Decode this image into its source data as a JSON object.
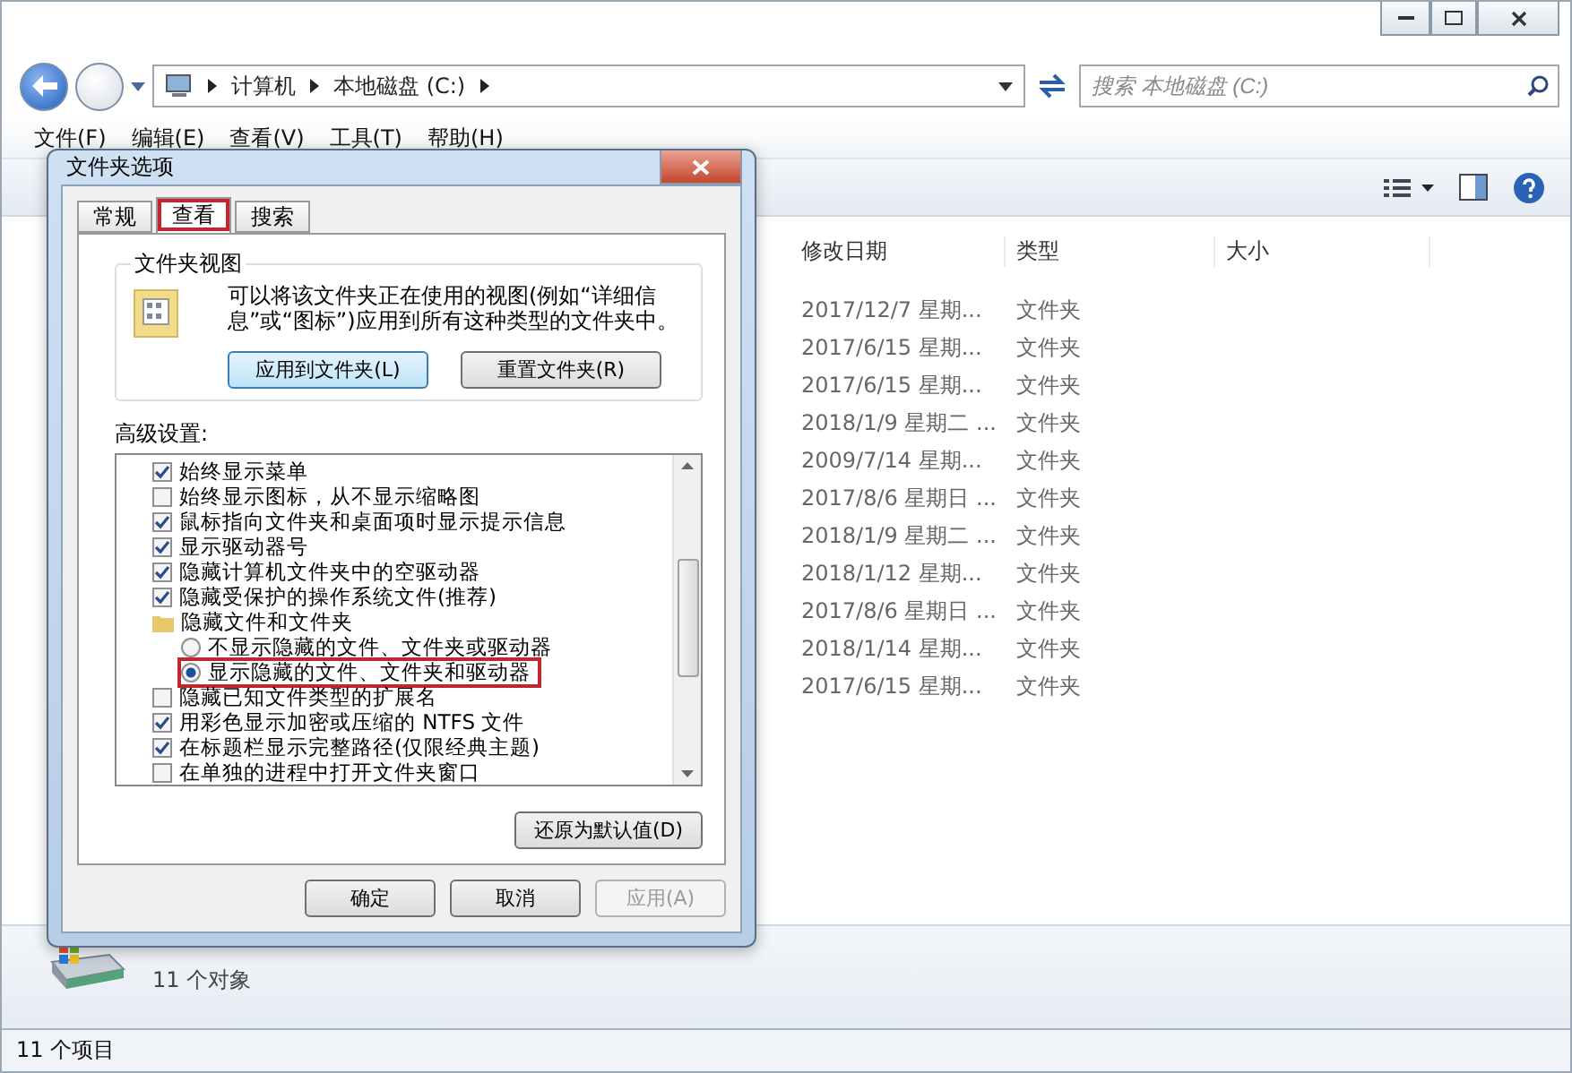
{
  "explorer": {
    "breadcrumb": [
      "计算机",
      "本地磁盘 (C:)"
    ],
    "search": {
      "placeholder": "搜索 本地磁盘 (C:)"
    },
    "menu": [
      "文件(F)",
      "编辑(E)",
      "查看(V)",
      "工具(T)",
      "帮助(H)"
    ],
    "columns": [
      "修改日期",
      "类型",
      "大小"
    ],
    "rows": [
      {
        "date": "2017/12/7 星期...",
        "type": "文件夹"
      },
      {
        "date": "2017/6/15 星期...",
        "type": "文件夹"
      },
      {
        "date": "2017/6/15 星期...",
        "type": "文件夹"
      },
      {
        "date": "2018/1/9 星期二 ...",
        "type": "文件夹"
      },
      {
        "date": "2009/7/14 星期...",
        "type": "文件夹"
      },
      {
        "date": "2017/8/6 星期日 ...",
        "type": "文件夹"
      },
      {
        "date": "2018/1/9 星期二 ...",
        "type": "文件夹"
      },
      {
        "date": "2018/1/12 星期...",
        "type": "文件夹"
      },
      {
        "date": "2017/8/6 星期日 ...",
        "type": "文件夹"
      },
      {
        "date": "2018/1/14 星期...",
        "type": "文件夹"
      },
      {
        "date": "2017/6/15 星期...",
        "type": "文件夹"
      }
    ],
    "details": "11 个对象",
    "status_bar": "11 个项目"
  },
  "dialog": {
    "title": "文件夹选项",
    "tabs": [
      {
        "label": "常规",
        "selected": false,
        "highlighted": false
      },
      {
        "label": "查看",
        "selected": true,
        "highlighted": true
      },
      {
        "label": "搜索",
        "selected": false,
        "highlighted": false
      }
    ],
    "folder_views": {
      "title": "文件夹视图",
      "description": "可以将该文件夹正在使用的视图(例如“详细信息”或“图标”)应用到所有这种类型的文件夹中。",
      "buttons": [
        "应用到文件夹(L)",
        "重置文件夹(R)"
      ]
    },
    "advanced_label": "高级设置:",
    "settings": [
      {
        "kind": "checkbox",
        "label": "始终显示菜单",
        "checked": true
      },
      {
        "kind": "checkbox",
        "label": "始终显示图标，从不显示缩略图",
        "checked": false
      },
      {
        "kind": "checkbox",
        "label": "鼠标指向文件夹和桌面项时显示提示信息",
        "checked": true
      },
      {
        "kind": "checkbox",
        "label": "显示驱动器号",
        "checked": true
      },
      {
        "kind": "checkbox",
        "label": "隐藏计算机文件夹中的空驱动器",
        "checked": true
      },
      {
        "kind": "checkbox",
        "label": "隐藏受保护的操作系统文件(推荐)",
        "checked": true
      },
      {
        "kind": "folder",
        "label": "隐藏文件和文件夹",
        "children": [
          {
            "kind": "radio",
            "label": "不显示隐藏的文件、文件夹或驱动器",
            "selected": false,
            "highlighted": false
          },
          {
            "kind": "radio",
            "label": "显示隐藏的文件、文件夹和驱动器",
            "selected": true,
            "highlighted": true
          }
        ]
      },
      {
        "kind": "checkbox",
        "label": "隐藏已知文件类型的扩展名",
        "checked": false
      },
      {
        "kind": "checkbox",
        "label": "用彩色显示加密或压缩的 NTFS 文件",
        "checked": true
      },
      {
        "kind": "checkbox",
        "label": "在标题栏显示完整路径(仅限经典主题)",
        "checked": true
      },
      {
        "kind": "checkbox",
        "label": "在单独的进程中打开文件夹窗口",
        "checked": false
      }
    ],
    "restore_button": "还原为默认值(D)",
    "buttons": [
      {
        "label": "确定",
        "disabled": false
      },
      {
        "label": "取消",
        "disabled": false
      },
      {
        "label": "应用(A)",
        "disabled": true
      }
    ]
  }
}
